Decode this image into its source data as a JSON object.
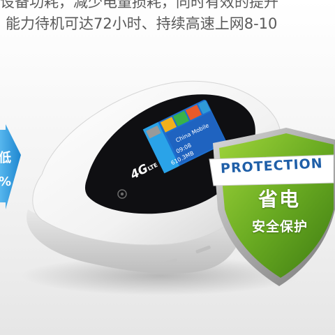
{
  "headline": {
    "line1": "设备功耗，减少电量损耗，同时有效的提升",
    "line2": "能力待机可达72小时、持续高速上网8-10"
  },
  "badge": {
    "text_top": "低",
    "text_bottom": "%",
    "color": "#2b9be0"
  },
  "device": {
    "logo_main": "4G",
    "logo_sub": "LTE",
    "screen": {
      "carrier": "China Mobile",
      "time": "09:08",
      "data": "610.3MB"
    }
  },
  "shield": {
    "title": "PROTECTION",
    "big_text": "省电",
    "small_text": "安全保护",
    "color": "#7ab829",
    "ribbon_color": "#ffffff",
    "title_color": "#1f5fa8"
  }
}
